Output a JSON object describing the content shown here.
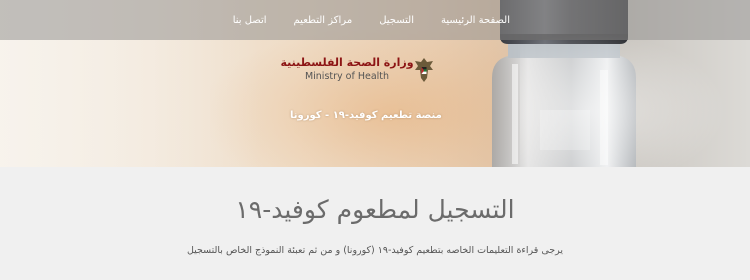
{
  "nav": {
    "items": [
      {
        "label": "الصفحة الرئيسية"
      },
      {
        "label": "التسجيل"
      },
      {
        "label": "مراكز التطعيم"
      },
      {
        "label": "اتصل بنا"
      }
    ]
  },
  "header": {
    "ministry_ar": "وزارة الصحة الفلسطينية",
    "ministry_en": "Ministry of Health",
    "platform": "منصة تطعيم كوفيد-١٩ - كورونا",
    "emblem_icon": "eagle-emblem-icon"
  },
  "main": {
    "title": "التسجيل لمطعوم كوفيد-١٩",
    "instructions": "يرجى قراءة التعليمات الخاصه بتطعيم كوفيد-١٩ (كورونا) و من ثم تعبئة النموذج الخاص بالتسجيل"
  },
  "colors": {
    "nav_bg": "#969492",
    "ministry_red": "#8c1414",
    "content_bg": "#f0f0f0",
    "title_color": "#6b6b6b"
  }
}
